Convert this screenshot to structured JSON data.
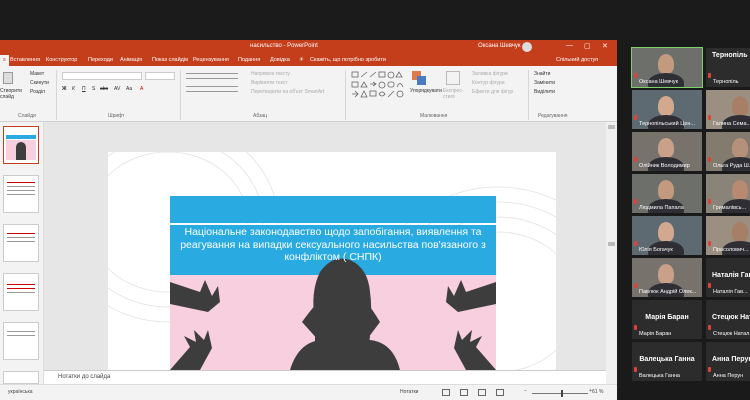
{
  "window": {
    "title": "насильство - PowerPoint",
    "user": "Оксана Шевчук",
    "controls": [
      "—",
      "▢",
      "✕"
    ]
  },
  "tabs": [
    "Файл",
    "Вставлення",
    "Конструктор",
    "Переходи",
    "Анімація",
    "Показ слайдів",
    "Рецензування",
    "Подання",
    "Довідка"
  ],
  "tell_me": "Скажіть, що потрібно зробити",
  "share": "Спільний доступ",
  "ribbon": {
    "clipboard": "Буфер обміну",
    "new_slide": "Створити слайд",
    "slides_group": "Слайди",
    "layout": "Макет",
    "reset": "Скинути",
    "section": "Розділ",
    "font_group": "Шрифт",
    "paragraph_group": "Абзац",
    "text_direction": "Напрямок тексту",
    "align_text": "Вирівняти текст",
    "convert_smartart": "Перетворити на об'єкт SmartArt",
    "drawing_group": "Малювання",
    "arrange": "Упорядкувати",
    "quick_styles": "Експрес-стилі",
    "shape_fill": "Заливка фігури",
    "shape_outline": "Контур фігури",
    "shape_effects": "Ефекти для фігур",
    "find": "Знайти",
    "replace": "Замінити",
    "select": "Виділити",
    "editing_group": "Редагування",
    "font_buttons": [
      "Ж",
      "К",
      "П",
      "S",
      "abc",
      "AV",
      "Aa",
      "A"
    ]
  },
  "slide": {
    "title": "Національне законодавство щодо запобігання, виявлення та реагування на випадки сексуального насильства пов'язаного з конфліктом ( СНПК)",
    "colors": {
      "banner": "#29abe2",
      "pink": "#f7cfdf",
      "figure": "#3d3d3d"
    }
  },
  "notes_placeholder": "Нотатки до слайда",
  "status": {
    "language": "українська",
    "notes_button": "Нотатки",
    "zoom": "61 %"
  },
  "participants": [
    {
      "name": "Оксана Шевчук",
      "video": true,
      "col": 0,
      "row": 0,
      "highlight": true
    },
    {
      "name": "Тернопіль",
      "video": false,
      "col": 1,
      "row": 0
    },
    {
      "name": "Тернопільський Цен...",
      "video": true,
      "col": 0,
      "row": 1
    },
    {
      "name": "Галина Сема...",
      "video": true,
      "col": 1,
      "row": 1
    },
    {
      "name": "Олійник Володимир",
      "video": true,
      "col": 0,
      "row": 2
    },
    {
      "name": "Ольга Руда Ш...",
      "video": true,
      "col": 1,
      "row": 2
    },
    {
      "name": "Людмила Папала",
      "video": true,
      "col": 0,
      "row": 3
    },
    {
      "name": "Грималівсь...",
      "video": true,
      "col": 1,
      "row": 3
    },
    {
      "name": "Юлія Богачук",
      "video": true,
      "col": 0,
      "row": 4
    },
    {
      "name": "Прасолович...",
      "video": true,
      "col": 1,
      "row": 4
    },
    {
      "name": "Павлюк Андрій Олек...",
      "video": true,
      "col": 0,
      "row": 5
    },
    {
      "name": "Наталія Гав...",
      "video": false,
      "col": 1,
      "row": 5,
      "big": "Наталія Гав"
    },
    {
      "name": "Марія Баран",
      "video": false,
      "col": 0,
      "row": 6,
      "big": "Марія Баран"
    },
    {
      "name": "Стецюк Натал...",
      "video": false,
      "col": 1,
      "row": 6,
      "big": "Стецюк Ната"
    },
    {
      "name": "Валецька Ганна",
      "video": false,
      "col": 0,
      "row": 7,
      "big": "Валецька Ганна"
    },
    {
      "name": "Анна Перун",
      "video": false,
      "col": 1,
      "row": 7,
      "big": "Анна Перун"
    }
  ]
}
